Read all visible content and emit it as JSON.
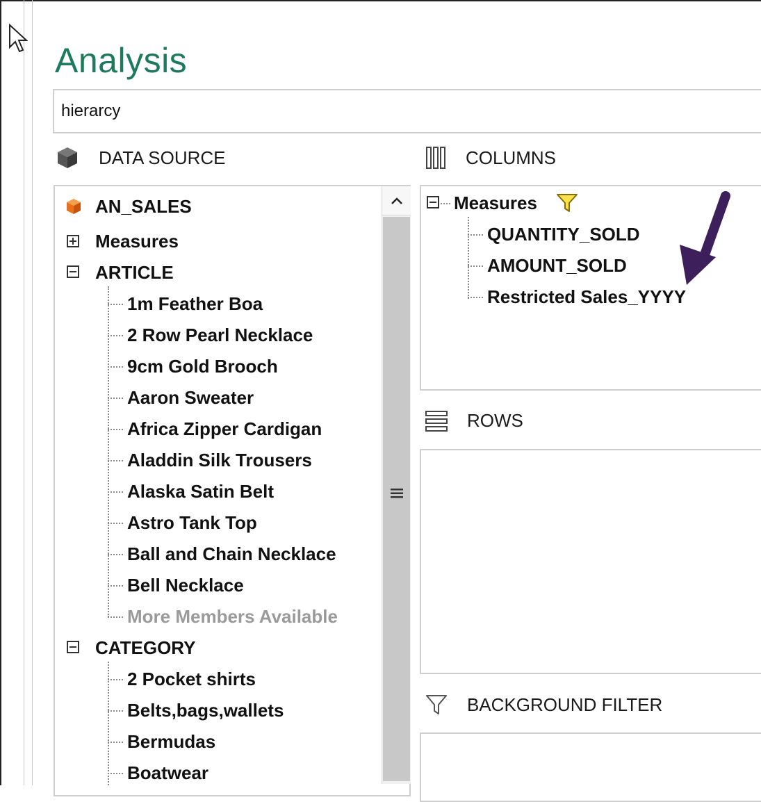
{
  "title": "Analysis",
  "search": {
    "value": "hierarcy"
  },
  "data_source": {
    "header": "DATA SOURCE",
    "root": "AN_SALES",
    "measures_label": "Measures",
    "article": {
      "label": "ARTICLE",
      "items": [
        "1m Feather Boa",
        "2 Row Pearl Necklace",
        "9cm Gold Brooch",
        "Aaron Sweater",
        "Africa Zipper Cardigan",
        "Aladdin Silk Trousers",
        "Alaska Satin Belt",
        "Astro Tank Top",
        "Ball and Chain Necklace",
        "Bell Necklace"
      ],
      "more": "More Members Available"
    },
    "category": {
      "label": "CATEGORY",
      "items": [
        "2 Pocket shirts",
        "Belts,bags,wallets",
        "Bermudas",
        "Boatwear"
      ]
    }
  },
  "columns": {
    "header": "COLUMNS",
    "measures_label": "Measures",
    "items": [
      "QUANTITY_SOLD",
      "AMOUNT_SOLD",
      "Restricted Sales_YYYY"
    ]
  },
  "rows": {
    "header": "ROWS"
  },
  "background_filter": {
    "header": "BACKGROUND FILTER"
  },
  "colors": {
    "title": "#1d7a5d",
    "arrow": "#3d1f5c",
    "filter_icon": "#e6c200",
    "cube_icon": "#e8711c"
  }
}
